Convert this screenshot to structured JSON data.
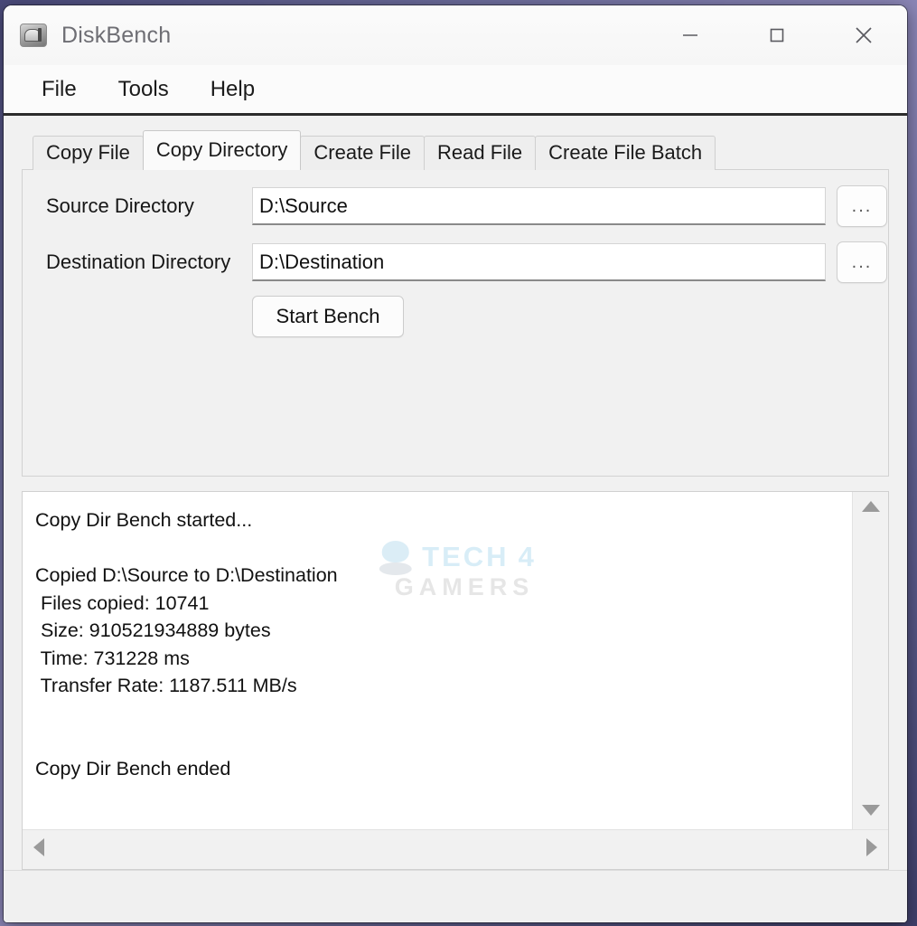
{
  "window": {
    "title": "DiskBench",
    "app_icon": "disk-drive-icon",
    "controls": {
      "minimize": "minimize-icon",
      "maximize": "maximize-icon",
      "close": "close-icon"
    }
  },
  "menubar": {
    "items": [
      {
        "label": "File"
      },
      {
        "label": "Tools"
      },
      {
        "label": "Help"
      }
    ]
  },
  "tabs": {
    "selected_index": 1,
    "items": [
      {
        "label": "Copy File"
      },
      {
        "label": "Copy Directory"
      },
      {
        "label": "Create File"
      },
      {
        "label": "Read File"
      },
      {
        "label": "Create File Batch"
      }
    ]
  },
  "form": {
    "source": {
      "label": "Source Directory",
      "value": "D:\\Source",
      "placeholder": "",
      "browse_label": "..."
    },
    "destination": {
      "label": "Destination Directory",
      "value": "D:\\Destination",
      "placeholder": "",
      "browse_label": "..."
    },
    "start_button_label": "Start Bench"
  },
  "watermark": {
    "line1_a": "TECH",
    "line1_b": "4",
    "line2": "GAMERS"
  },
  "log": {
    "text": "Copy Dir Bench started...\n\nCopied D:\\Source to D:\\Destination\n Files copied: 10741\n Size: 910521934889 bytes\n Time: 731228 ms\n Transfer Rate: 1187.511 MB/s\n\n\nCopy Dir Bench ended",
    "results": {
      "started_line": "Copy Dir Bench started...",
      "copied_line": "Copied D:\\Source to D:\\Destination",
      "files_copied_label": "Files copied:",
      "files_copied": "10741",
      "size_label": "Size:",
      "size": "910521934889 bytes",
      "time_label": "Time:",
      "time": "731228 ms",
      "transfer_rate_label": "Transfer Rate:",
      "transfer_rate": "1187.511 MB/s",
      "ended_line": "Copy Dir Bench ended"
    },
    "scrollbars": {
      "up_arrow": "scroll-up-icon",
      "down_arrow": "scroll-down-icon",
      "left_arrow": "scroll-left-icon",
      "right_arrow": "scroll-right-icon"
    }
  },
  "colors": {
    "window_bg": "#f1f1f1",
    "titlebar_bg": "#fbfbfb",
    "text": "#111111",
    "title_text": "#6e6e74",
    "selected_tab_bg": "#fafafa",
    "watermark_blue": "#b9dff1",
    "watermark_gray": "#d2d2d2",
    "desktop": "#6b6b9a"
  }
}
